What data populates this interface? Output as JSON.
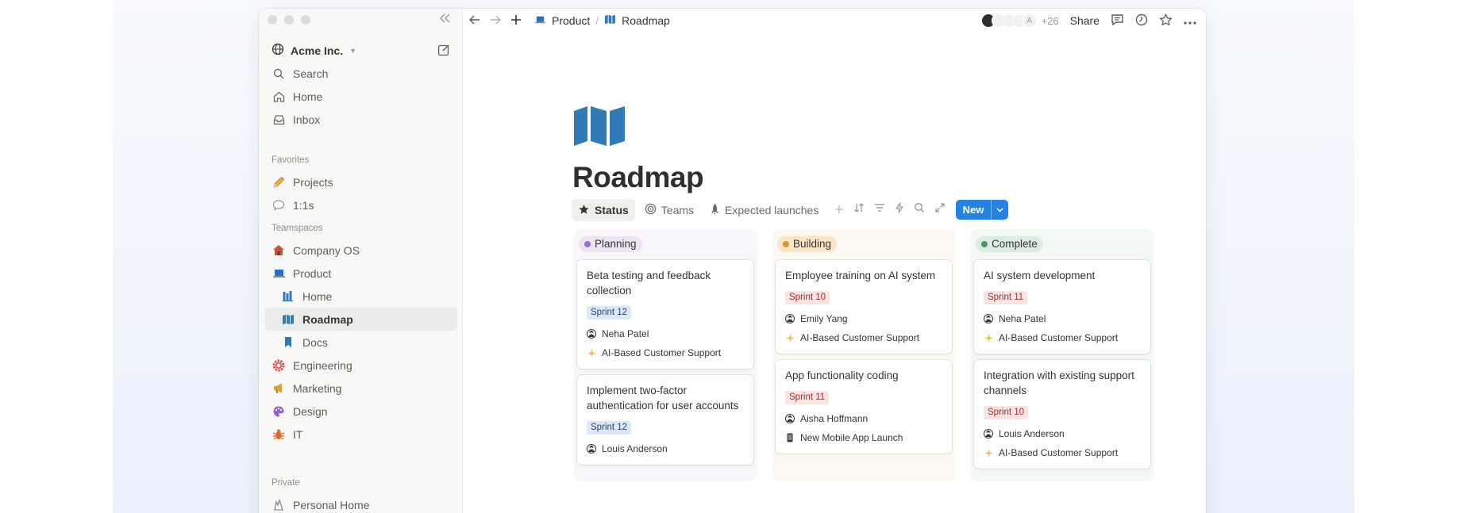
{
  "workspace": {
    "name": "Acme Inc."
  },
  "sidebar": {
    "top": [
      {
        "label": "Search",
        "icon": "search-icon"
      },
      {
        "label": "Home",
        "icon": "home-icon"
      },
      {
        "label": "Inbox",
        "icon": "inbox-icon"
      }
    ],
    "favorites_label": "Favorites",
    "favorites": [
      {
        "label": "Projects",
        "icon": "pencil-icon"
      },
      {
        "label": "1:1s",
        "icon": "speech-bubble-icon"
      }
    ],
    "teamspaces_label": "Teamspaces",
    "teamspaces": [
      {
        "label": "Company OS",
        "icon": "house-icon"
      },
      {
        "label": "Product",
        "icon": "laptop-icon"
      },
      {
        "label": "Home",
        "icon": "books-icon"
      },
      {
        "label": "Roadmap",
        "icon": "map-icon"
      },
      {
        "label": "Docs",
        "icon": "bookmark-icon"
      },
      {
        "label": "Engineering",
        "icon": "gear-icon"
      },
      {
        "label": "Marketing",
        "icon": "megaphone-icon"
      },
      {
        "label": "Design",
        "icon": "palette-icon"
      },
      {
        "label": "IT",
        "icon": "bug-icon"
      }
    ],
    "private_label": "Private",
    "private": [
      {
        "label": "Personal Home",
        "icon": "wave-icon"
      }
    ]
  },
  "topbar": {
    "breadcrumb": [
      "Product",
      "Roadmap"
    ],
    "avatar_letter": "A",
    "more_count": "+26",
    "share": "Share"
  },
  "page": {
    "title": "Roadmap",
    "tabs": [
      "Status",
      "Teams",
      "Expected launches"
    ],
    "new_button": "New"
  },
  "colors": {
    "accent": "#2383e2",
    "page_icon": "#2f7bb5"
  },
  "board": {
    "columns": [
      {
        "label": "Planning",
        "bg": "#f8f5fb",
        "pill": "#ece4f3",
        "dot": "#9a6dd7",
        "cards": [
          {
            "title": "Beta testing and feedback collection",
            "sprint": "Sprint 12",
            "sprint_color": "blue",
            "person": "Neha Patel",
            "project": "AI-Based Customer Support",
            "project_icon": "sparkles-icon"
          },
          {
            "title": "Implement two-factor authentication for user accounts",
            "sprint": "Sprint 12",
            "sprint_color": "blue",
            "person": "Louis Anderson",
            "project": "",
            "project_icon": ""
          }
        ]
      },
      {
        "label": "Building",
        "bg": "#fcf9f0",
        "pill": "#f9e6c8",
        "dot": "#d99a2b",
        "cards": [
          {
            "title": "Employee training on AI system",
            "sprint": "Sprint 10",
            "sprint_color": "red",
            "person": "Emily Yang",
            "project": "AI-Based Customer Support",
            "project_icon": "sparkles-icon"
          },
          {
            "title": "App functionality coding",
            "sprint": "Sprint 11",
            "sprint_color": "red",
            "person": "Aisha Hoffmann",
            "project": "New Mobile App Launch",
            "project_icon": "phone-icon"
          }
        ]
      },
      {
        "label": "Complete",
        "bg": "#f3f8f4",
        "pill": "#dcece0",
        "dot": "#4f9768",
        "cards": [
          {
            "title": "AI system development",
            "sprint": "Sprint 11",
            "sprint_color": "red",
            "person": "Neha Patel",
            "project": "AI-Based Customer Support",
            "project_icon": "sparkles-icon"
          },
          {
            "title": "Integration with existing support channels",
            "sprint": "Sprint 10",
            "sprint_color": "red",
            "person": "Louis Anderson",
            "project": "AI-Based Customer Support",
            "project_icon": "sparkles-icon"
          }
        ]
      }
    ]
  }
}
